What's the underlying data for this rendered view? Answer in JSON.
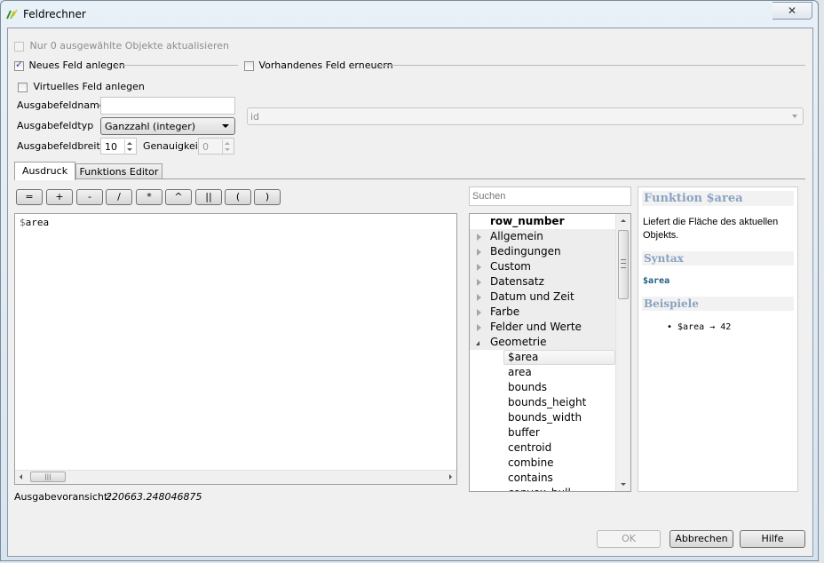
{
  "window": {
    "title": "Feldrechner",
    "help_button": "?",
    "close_button": "✕"
  },
  "options": {
    "only_selected": {
      "label": "Nur 0 ausgewählte Objekte aktualisieren",
      "checked": false,
      "enabled": false
    },
    "new_field": {
      "label": "Neues Feld anlegen",
      "checked": true
    },
    "update_field": {
      "label": "Vorhandenes Feld erneuern",
      "checked": false
    },
    "virtual_field": {
      "label": "Virtuelles Feld anlegen",
      "checked": false
    }
  },
  "form": {
    "name_label": "Ausgabefeldname",
    "name_value": "",
    "type_label": "Ausgabefeldtyp",
    "type_value": "Ganzzahl (integer)",
    "width_label": "Ausgabefeldbreite",
    "width_value": "10",
    "precision_label": "Genauigkeit",
    "precision_value": "0",
    "existing_field_value": "id"
  },
  "tabs": [
    {
      "label": "Ausdruck",
      "active": true
    },
    {
      "label": "Funktions Editor",
      "active": false
    }
  ],
  "operators": [
    "=",
    "+",
    "-",
    "/",
    "*",
    "^",
    "||",
    "(",
    ")"
  ],
  "expression": {
    "dollar": "$",
    "rest": "area"
  },
  "search": {
    "placeholder": "Suchen"
  },
  "tree": {
    "items": [
      {
        "label": "row_number",
        "type": "top",
        "bold": true
      },
      {
        "label": "Allgemein",
        "type": "group"
      },
      {
        "label": "Bedingungen",
        "type": "group"
      },
      {
        "label": "Custom",
        "type": "group"
      },
      {
        "label": "Datensatz",
        "type": "group"
      },
      {
        "label": "Datum und Zeit",
        "type": "group"
      },
      {
        "label": "Farbe",
        "type": "group"
      },
      {
        "label": "Felder und Werte",
        "type": "group"
      },
      {
        "label": "Geometrie",
        "type": "group-open"
      },
      {
        "label": "$area",
        "type": "child",
        "selected": true
      },
      {
        "label": "area",
        "type": "child"
      },
      {
        "label": "bounds",
        "type": "child"
      },
      {
        "label": "bounds_height",
        "type": "child"
      },
      {
        "label": "bounds_width",
        "type": "child"
      },
      {
        "label": "buffer",
        "type": "child"
      },
      {
        "label": "centroid",
        "type": "child"
      },
      {
        "label": "combine",
        "type": "child"
      },
      {
        "label": "contains",
        "type": "child"
      },
      {
        "label": "convex_hull",
        "type": "child"
      }
    ]
  },
  "help": {
    "title": "Funktion $area",
    "description": "Liefert die Fläche des aktuellen Objekts.",
    "syntax_heading": "Syntax",
    "syntax": "$area",
    "examples_heading": "Beispiele",
    "example": "• $area → 42"
  },
  "preview": {
    "label": "Ausgabevoransicht:",
    "value": "220663.248046875"
  },
  "buttons": {
    "ok": "OK",
    "cancel": "Abbrechen",
    "help": "Hilfe"
  }
}
